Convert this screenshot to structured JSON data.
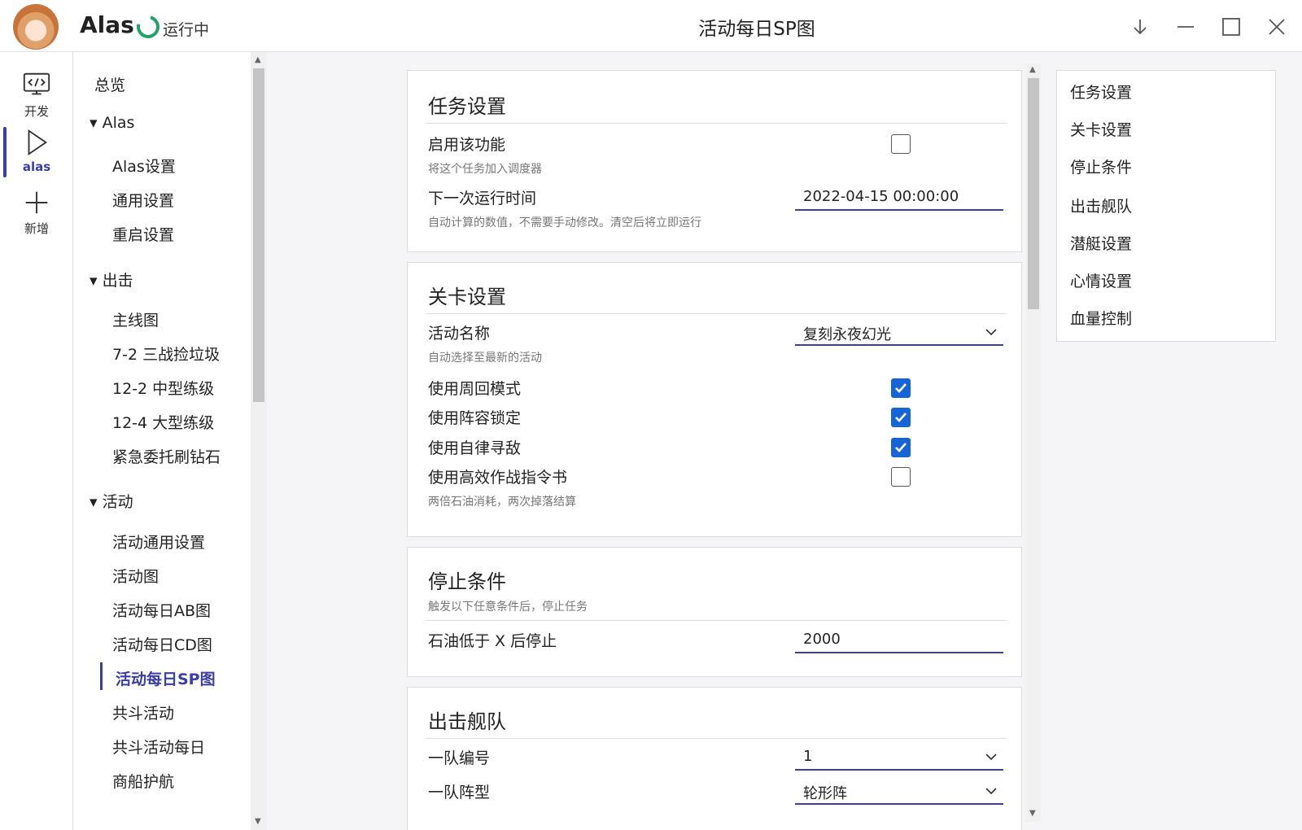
{
  "app": {
    "name": "Alas",
    "status": "运行中",
    "window_title": "活动每日SP图"
  },
  "rail": {
    "items": [
      {
        "label": "开发",
        "icon": "code-monitor-icon"
      },
      {
        "label": "alas",
        "icon": "play-icon",
        "active": true
      },
      {
        "label": "新增",
        "icon": "plus-icon"
      }
    ]
  },
  "nav": {
    "overview": "总览",
    "groups": [
      {
        "label": "Alas",
        "children": [
          "Alas设置",
          "通用设置",
          "重启设置"
        ]
      },
      {
        "label": "出击",
        "children": [
          "主线图",
          "7-2 三战捡垃圾",
          "12-2 中型练级",
          "12-4 大型练级",
          "紧急委托刷钻石"
        ]
      },
      {
        "label": "活动",
        "children": [
          "活动通用设置",
          "活动图",
          "活动每日AB图",
          "活动每日CD图",
          "活动每日SP图",
          "共斗活动",
          "共斗活动每日",
          "商船护航"
        ]
      }
    ],
    "active": "活动每日SP图"
  },
  "cards": {
    "task": {
      "title": "任务设置",
      "enable_label": "启用该功能",
      "enable_help": "将这个任务加入调度器",
      "enable_checked": false,
      "next_run_label": "下一次运行时间",
      "next_run_help": "自动计算的数值，不需要手动修改。清空后将立即运行",
      "next_run_value": "2022-04-15 00:00:00"
    },
    "stage": {
      "title": "关卡设置",
      "event_label": "活动名称",
      "event_help": "自动选择至最新的活动",
      "event_value": "复刻永夜幻光",
      "loop_label": "使用周回模式",
      "loop_checked": true,
      "lock_label": "使用阵容锁定",
      "lock_checked": true,
      "auto_label": "使用自律寻敌",
      "auto_checked": true,
      "book_label": "使用高效作战指令书",
      "book_checked": false,
      "book_help": "两倍石油消耗，两次掉落结算"
    },
    "stop": {
      "title": "停止条件",
      "subtitle": "触发以下任意条件后，停止任务",
      "oil_label": "石油低于 X 后停止",
      "oil_value": "2000"
    },
    "fleet": {
      "title": "出击舰队",
      "fleet1_label": "一队编号",
      "fleet1_value": "1",
      "formation_label": "一队阵型",
      "formation_value": "轮形阵"
    }
  },
  "toc": [
    "任务设置",
    "关卡设置",
    "停止条件",
    "出击舰队",
    "潜艇设置",
    "心情设置",
    "血量控制"
  ],
  "colors": {
    "accent": "#3c3ea7",
    "checkbox": "#1565d8",
    "running": "#21a366"
  }
}
